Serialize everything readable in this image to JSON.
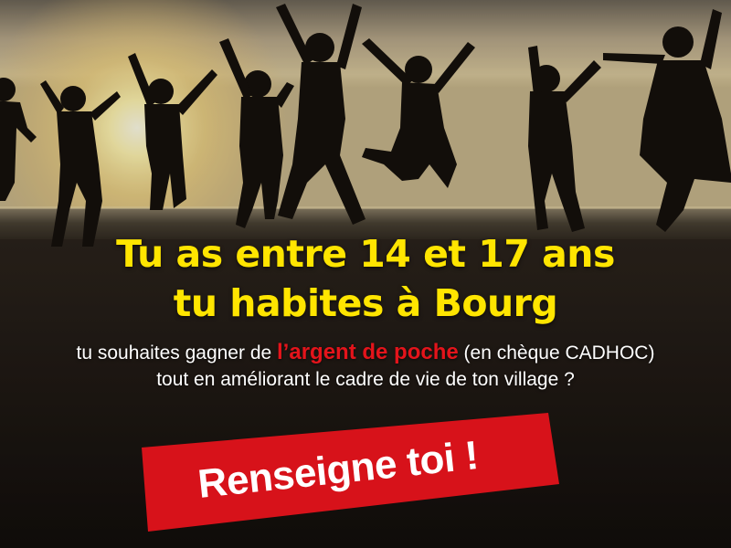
{
  "headline": {
    "line1": "Tu as entre 14 et 17 ans",
    "line2": "tu habites à Bourg"
  },
  "subtext": {
    "line1_before": "tu souhaites gagner de ",
    "line1_highlight": "l’argent de poche",
    "line1_after": " (en chèque CADHOC)",
    "line2": "tout en améliorant le cadre de vie de ton village ?"
  },
  "cta": {
    "label": "Renseigne toi !"
  },
  "colors": {
    "headline": "#FFE500",
    "highlight": "#E4141B",
    "banner": "#D7121A",
    "text": "#FFFFFF"
  }
}
